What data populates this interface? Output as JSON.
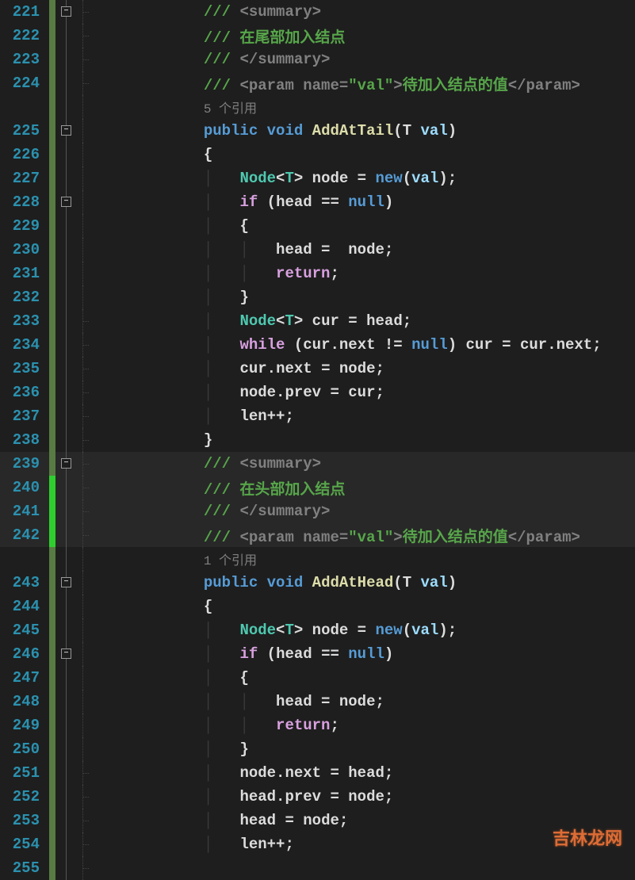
{
  "watermark": "吉林龙网",
  "lines": [
    {
      "num": "221",
      "fold": "box",
      "tick": true,
      "indent": 0,
      "hl": false,
      "bar": "g",
      "spans": [
        {
          "cls": "c-comment",
          "t": "/// "
        },
        {
          "cls": "c-str-attr",
          "t": "<summary>"
        }
      ]
    },
    {
      "num": "222",
      "fold": "line",
      "tick": true,
      "indent": 0,
      "hl": false,
      "bar": "g",
      "spans": [
        {
          "cls": "c-comment",
          "t": "/// 在尾部加入结点"
        }
      ]
    },
    {
      "num": "223",
      "fold": "line",
      "tick": true,
      "indent": 0,
      "hl": false,
      "bar": "g",
      "spans": [
        {
          "cls": "c-comment",
          "t": "/// "
        },
        {
          "cls": "c-str-attr",
          "t": "</summary>"
        }
      ]
    },
    {
      "num": "224",
      "fold": "line",
      "tick": true,
      "indent": 0,
      "hl": false,
      "bar": "g",
      "spans": [
        {
          "cls": "c-comment",
          "t": "/// "
        },
        {
          "cls": "c-str-attr",
          "t": "<param name="
        },
        {
          "cls": "c-comment",
          "t": "\"val\""
        },
        {
          "cls": "c-str-attr",
          "t": ">"
        },
        {
          "cls": "c-comment",
          "t": "待加入结点的值"
        },
        {
          "cls": "c-str-attr",
          "t": "</param>"
        }
      ]
    },
    {
      "num": "",
      "fold": "line",
      "tick": false,
      "indent": 0,
      "hl": false,
      "bar": "g",
      "spans": [
        {
          "cls": "c-codelens",
          "t": "5 个引用"
        }
      ]
    },
    {
      "num": "225",
      "fold": "box",
      "tick": false,
      "indent": 0,
      "hl": false,
      "bar": "g",
      "spans": [
        {
          "cls": "c-keyword",
          "t": "public"
        },
        {
          "cls": "c-punc",
          "t": " "
        },
        {
          "cls": "c-keyword",
          "t": "void"
        },
        {
          "cls": "c-punc",
          "t": " "
        },
        {
          "cls": "c-method",
          "t": "AddAtTail"
        },
        {
          "cls": "c-punc",
          "t": "(T "
        },
        {
          "cls": "c-param",
          "t": "val"
        },
        {
          "cls": "c-punc",
          "t": ")"
        }
      ]
    },
    {
      "num": "226",
      "fold": "line",
      "tick": false,
      "indent": 0,
      "hl": false,
      "bar": "g",
      "spans": [
        {
          "cls": "c-punc",
          "t": "{"
        }
      ]
    },
    {
      "num": "227",
      "fold": "line",
      "tick": false,
      "indent": 1,
      "hl": false,
      "bar": "g",
      "spans": [
        {
          "cls": "c-type",
          "t": "Node"
        },
        {
          "cls": "c-punc",
          "t": "<"
        },
        {
          "cls": "c-type",
          "t": "T"
        },
        {
          "cls": "c-punc",
          "t": "> "
        },
        {
          "cls": "c-local",
          "t": "node"
        },
        {
          "cls": "c-punc",
          "t": " = "
        },
        {
          "cls": "c-keyword",
          "t": "new"
        },
        {
          "cls": "c-punc",
          "t": "("
        },
        {
          "cls": "c-param",
          "t": "val"
        },
        {
          "cls": "c-punc",
          "t": ");"
        }
      ]
    },
    {
      "num": "228",
      "fold": "box",
      "tick": false,
      "indent": 1,
      "hl": false,
      "bar": "g",
      "spans": [
        {
          "cls": "c-ctrl",
          "t": "if"
        },
        {
          "cls": "c-punc",
          "t": " ("
        },
        {
          "cls": "c-field",
          "t": "head"
        },
        {
          "cls": "c-punc",
          "t": " == "
        },
        {
          "cls": "c-keyword",
          "t": "null"
        },
        {
          "cls": "c-punc",
          "t": ")"
        }
      ]
    },
    {
      "num": "229",
      "fold": "line",
      "tick": false,
      "indent": 1,
      "hl": false,
      "bar": "g",
      "spans": [
        {
          "cls": "c-punc",
          "t": "{"
        }
      ]
    },
    {
      "num": "230",
      "fold": "line",
      "tick": false,
      "indent": 2,
      "hl": false,
      "bar": "g",
      "spans": [
        {
          "cls": "c-field",
          "t": "head"
        },
        {
          "cls": "c-punc",
          "t": " =  "
        },
        {
          "cls": "c-local",
          "t": "node"
        },
        {
          "cls": "c-punc",
          "t": ";"
        }
      ]
    },
    {
      "num": "231",
      "fold": "line",
      "tick": false,
      "indent": 2,
      "hl": false,
      "bar": "g",
      "spans": [
        {
          "cls": "c-ctrl",
          "t": "return"
        },
        {
          "cls": "c-punc",
          "t": ";"
        }
      ]
    },
    {
      "num": "232",
      "fold": "line",
      "tick": false,
      "indent": 1,
      "hl": false,
      "bar": "g",
      "spans": [
        {
          "cls": "c-punc",
          "t": "}"
        }
      ]
    },
    {
      "num": "233",
      "fold": "line",
      "tick": true,
      "indent": 1,
      "hl": false,
      "bar": "g",
      "spans": [
        {
          "cls": "c-type",
          "t": "Node"
        },
        {
          "cls": "c-punc",
          "t": "<"
        },
        {
          "cls": "c-type",
          "t": "T"
        },
        {
          "cls": "c-punc",
          "t": "> "
        },
        {
          "cls": "c-local",
          "t": "cur"
        },
        {
          "cls": "c-punc",
          "t": " = "
        },
        {
          "cls": "c-field",
          "t": "head"
        },
        {
          "cls": "c-punc",
          "t": ";"
        }
      ]
    },
    {
      "num": "234",
      "fold": "line",
      "tick": true,
      "indent": 1,
      "hl": false,
      "bar": "g",
      "spans": [
        {
          "cls": "c-ctrl",
          "t": "while"
        },
        {
          "cls": "c-punc",
          "t": " ("
        },
        {
          "cls": "c-local",
          "t": "cur"
        },
        {
          "cls": "c-punc",
          "t": "."
        },
        {
          "cls": "c-field",
          "t": "next"
        },
        {
          "cls": "c-punc",
          "t": " != "
        },
        {
          "cls": "c-keyword",
          "t": "null"
        },
        {
          "cls": "c-punc",
          "t": ") "
        },
        {
          "cls": "c-local",
          "t": "cur"
        },
        {
          "cls": "c-punc",
          "t": " = "
        },
        {
          "cls": "c-local",
          "t": "cur"
        },
        {
          "cls": "c-punc",
          "t": "."
        },
        {
          "cls": "c-field",
          "t": "next"
        },
        {
          "cls": "c-punc",
          "t": ";"
        }
      ]
    },
    {
      "num": "235",
      "fold": "line",
      "tick": true,
      "indent": 1,
      "hl": false,
      "bar": "g",
      "spans": [
        {
          "cls": "c-local",
          "t": "cur"
        },
        {
          "cls": "c-punc",
          "t": "."
        },
        {
          "cls": "c-field",
          "t": "next"
        },
        {
          "cls": "c-punc",
          "t": " = "
        },
        {
          "cls": "c-local",
          "t": "node"
        },
        {
          "cls": "c-punc",
          "t": ";"
        }
      ]
    },
    {
      "num": "236",
      "fold": "line",
      "tick": true,
      "indent": 1,
      "hl": false,
      "bar": "g",
      "spans": [
        {
          "cls": "c-local",
          "t": "node"
        },
        {
          "cls": "c-punc",
          "t": "."
        },
        {
          "cls": "c-field",
          "t": "prev"
        },
        {
          "cls": "c-punc",
          "t": " = "
        },
        {
          "cls": "c-local",
          "t": "cur"
        },
        {
          "cls": "c-punc",
          "t": ";"
        }
      ]
    },
    {
      "num": "237",
      "fold": "line",
      "tick": true,
      "indent": 1,
      "hl": false,
      "bar": "g",
      "spans": [
        {
          "cls": "c-field",
          "t": "len"
        },
        {
          "cls": "c-punc",
          "t": "++;"
        }
      ]
    },
    {
      "num": "238",
      "fold": "line",
      "tick": true,
      "indent": 0,
      "hl": false,
      "bar": "g",
      "spans": [
        {
          "cls": "c-punc",
          "t": "}"
        }
      ]
    },
    {
      "num": "239",
      "fold": "box",
      "tick": true,
      "indent": 0,
      "hl": true,
      "bar": "g",
      "spans": [
        {
          "cls": "c-comment",
          "t": "/// "
        },
        {
          "cls": "c-str-attr",
          "t": "<summary>"
        }
      ]
    },
    {
      "num": "240",
      "fold": "line",
      "tick": true,
      "indent": 0,
      "hl": true,
      "bar": "bg",
      "spans": [
        {
          "cls": "c-comment",
          "t": "/// 在头部加入结点"
        }
      ]
    },
    {
      "num": "241",
      "fold": "line",
      "tick": true,
      "indent": 0,
      "hl": true,
      "bar": "bg",
      "spans": [
        {
          "cls": "c-comment",
          "t": "/// "
        },
        {
          "cls": "c-str-attr",
          "t": "</summary>"
        }
      ]
    },
    {
      "num": "242",
      "fold": "line",
      "tick": true,
      "indent": 0,
      "hl": true,
      "bar": "bg",
      "spans": [
        {
          "cls": "c-comment",
          "t": "/// "
        },
        {
          "cls": "c-str-attr",
          "t": "<param name="
        },
        {
          "cls": "c-comment",
          "t": "\"val\""
        },
        {
          "cls": "c-str-attr",
          "t": ">"
        },
        {
          "cls": "c-comment",
          "t": "待加入结点的值"
        },
        {
          "cls": "c-str-attr",
          "t": "</param>"
        }
      ]
    },
    {
      "num": "",
      "fold": "line",
      "tick": false,
      "indent": 0,
      "hl": false,
      "bar": "g",
      "spans": [
        {
          "cls": "c-codelens",
          "t": "1 个引用"
        }
      ]
    },
    {
      "num": "243",
      "fold": "box",
      "tick": false,
      "indent": 0,
      "hl": false,
      "bar": "g",
      "spans": [
        {
          "cls": "c-keyword",
          "t": "public"
        },
        {
          "cls": "c-punc",
          "t": " "
        },
        {
          "cls": "c-keyword",
          "t": "void"
        },
        {
          "cls": "c-punc",
          "t": " "
        },
        {
          "cls": "c-method",
          "t": "AddAtHead"
        },
        {
          "cls": "c-punc",
          "t": "(T "
        },
        {
          "cls": "c-param",
          "t": "val"
        },
        {
          "cls": "c-punc",
          "t": ")"
        }
      ]
    },
    {
      "num": "244",
      "fold": "line",
      "tick": false,
      "indent": 0,
      "hl": false,
      "bar": "g",
      "spans": [
        {
          "cls": "c-punc",
          "t": "{"
        }
      ]
    },
    {
      "num": "245",
      "fold": "line",
      "tick": false,
      "indent": 1,
      "hl": false,
      "bar": "g",
      "spans": [
        {
          "cls": "c-type",
          "t": "Node"
        },
        {
          "cls": "c-punc",
          "t": "<"
        },
        {
          "cls": "c-type",
          "t": "T"
        },
        {
          "cls": "c-punc",
          "t": "> "
        },
        {
          "cls": "c-local",
          "t": "node"
        },
        {
          "cls": "c-punc",
          "t": " = "
        },
        {
          "cls": "c-keyword",
          "t": "new"
        },
        {
          "cls": "c-punc",
          "t": "("
        },
        {
          "cls": "c-param",
          "t": "val"
        },
        {
          "cls": "c-punc",
          "t": ");"
        }
      ]
    },
    {
      "num": "246",
      "fold": "box",
      "tick": false,
      "indent": 1,
      "hl": false,
      "bar": "g",
      "spans": [
        {
          "cls": "c-ctrl",
          "t": "if"
        },
        {
          "cls": "c-punc",
          "t": " ("
        },
        {
          "cls": "c-field",
          "t": "head"
        },
        {
          "cls": "c-punc",
          "t": " == "
        },
        {
          "cls": "c-keyword",
          "t": "null"
        },
        {
          "cls": "c-punc",
          "t": ")"
        }
      ]
    },
    {
      "num": "247",
      "fold": "line",
      "tick": false,
      "indent": 1,
      "hl": false,
      "bar": "g",
      "spans": [
        {
          "cls": "c-punc",
          "t": "{"
        }
      ]
    },
    {
      "num": "248",
      "fold": "line",
      "tick": false,
      "indent": 2,
      "hl": false,
      "bar": "g",
      "spans": [
        {
          "cls": "c-field",
          "t": "head"
        },
        {
          "cls": "c-punc",
          "t": " = "
        },
        {
          "cls": "c-local",
          "t": "node"
        },
        {
          "cls": "c-punc",
          "t": ";"
        }
      ]
    },
    {
      "num": "249",
      "fold": "line",
      "tick": false,
      "indent": 2,
      "hl": false,
      "bar": "g",
      "spans": [
        {
          "cls": "c-ctrl",
          "t": "return"
        },
        {
          "cls": "c-punc",
          "t": ";"
        }
      ]
    },
    {
      "num": "250",
      "fold": "line",
      "tick": false,
      "indent": 1,
      "hl": false,
      "bar": "g",
      "spans": [
        {
          "cls": "c-punc",
          "t": "}"
        }
      ]
    },
    {
      "num": "251",
      "fold": "line",
      "tick": true,
      "indent": 1,
      "hl": false,
      "bar": "g",
      "spans": [
        {
          "cls": "c-local",
          "t": "node"
        },
        {
          "cls": "c-punc",
          "t": "."
        },
        {
          "cls": "c-field",
          "t": "next"
        },
        {
          "cls": "c-punc",
          "t": " = "
        },
        {
          "cls": "c-field",
          "t": "head"
        },
        {
          "cls": "c-punc",
          "t": ";"
        }
      ]
    },
    {
      "num": "252",
      "fold": "line",
      "tick": true,
      "indent": 1,
      "hl": false,
      "bar": "g",
      "spans": [
        {
          "cls": "c-field",
          "t": "head"
        },
        {
          "cls": "c-punc",
          "t": "."
        },
        {
          "cls": "c-field",
          "t": "prev"
        },
        {
          "cls": "c-punc",
          "t": " = "
        },
        {
          "cls": "c-local",
          "t": "node"
        },
        {
          "cls": "c-punc",
          "t": ";"
        }
      ]
    },
    {
      "num": "253",
      "fold": "line",
      "tick": true,
      "indent": 1,
      "hl": false,
      "bar": "g",
      "spans": [
        {
          "cls": "c-field",
          "t": "head"
        },
        {
          "cls": "c-punc",
          "t": " = "
        },
        {
          "cls": "c-local",
          "t": "node"
        },
        {
          "cls": "c-punc",
          "t": ";"
        }
      ]
    },
    {
      "num": "254",
      "fold": "line",
      "tick": true,
      "indent": 1,
      "hl": false,
      "bar": "g",
      "spans": [
        {
          "cls": "c-field",
          "t": "len"
        },
        {
          "cls": "c-punc",
          "t": "++;"
        }
      ]
    },
    {
      "num": "255",
      "fold": "line",
      "tick": true,
      "indent": 0,
      "hl": false,
      "bar": "g",
      "spans": []
    }
  ]
}
